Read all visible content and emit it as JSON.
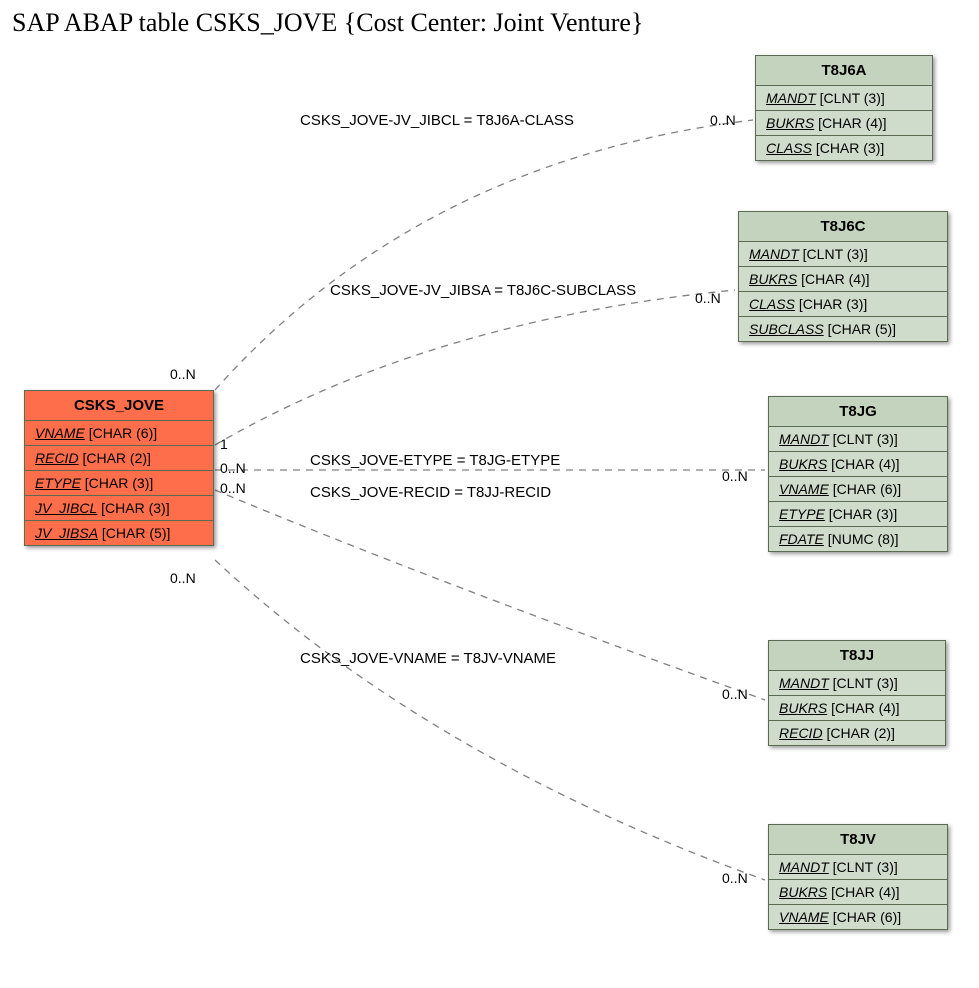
{
  "title": "SAP ABAP table CSKS_JOVE {Cost Center: Joint Venture}",
  "primary": {
    "name": "CSKS_JOVE",
    "fields": [
      {
        "name": "VNAME",
        "type": "[CHAR (6)]"
      },
      {
        "name": "RECID",
        "type": "[CHAR (2)]"
      },
      {
        "name": "ETYPE",
        "type": "[CHAR (3)]"
      },
      {
        "name": "JV_JIBCL",
        "type": "[CHAR (3)]"
      },
      {
        "name": "JV_JIBSA",
        "type": "[CHAR (5)]"
      }
    ]
  },
  "secondaries": [
    {
      "name": "T8J6A",
      "fields": [
        {
          "name": "MANDT",
          "type": "[CLNT (3)]"
        },
        {
          "name": "BUKRS",
          "type": "[CHAR (4)]"
        },
        {
          "name": "CLASS",
          "type": "[CHAR (3)]"
        }
      ]
    },
    {
      "name": "T8J6C",
      "fields": [
        {
          "name": "MANDT",
          "type": "[CLNT (3)]"
        },
        {
          "name": "BUKRS",
          "type": "[CHAR (4)]"
        },
        {
          "name": "CLASS",
          "type": "[CHAR (3)]"
        },
        {
          "name": "SUBCLASS",
          "type": "[CHAR (5)]"
        }
      ]
    },
    {
      "name": "T8JG",
      "fields": [
        {
          "name": "MANDT",
          "type": "[CLNT (3)]"
        },
        {
          "name": "BUKRS",
          "type": "[CHAR (4)]"
        },
        {
          "name": "VNAME",
          "type": "[CHAR (6)]"
        },
        {
          "name": "ETYPE",
          "type": "[CHAR (3)]"
        },
        {
          "name": "FDATE",
          "type": "[NUMC (8)]"
        }
      ]
    },
    {
      "name": "T8JJ",
      "fields": [
        {
          "name": "MANDT",
          "type": "[CLNT (3)]"
        },
        {
          "name": "BUKRS",
          "type": "[CHAR (4)]"
        },
        {
          "name": "RECID",
          "type": "[CHAR (2)]"
        }
      ]
    },
    {
      "name": "T8JV",
      "fields": [
        {
          "name": "MANDT",
          "type": "[CLNT (3)]"
        },
        {
          "name": "BUKRS",
          "type": "[CHAR (4)]"
        },
        {
          "name": "VNAME",
          "type": "[CHAR (6)]"
        }
      ]
    }
  ],
  "relations": {
    "r1": "CSKS_JOVE-JV_JIBCL = T8J6A-CLASS",
    "r2": "CSKS_JOVE-JV_JIBSA = T8J6C-SUBCLASS",
    "r3": "CSKS_JOVE-ETYPE = T8JG-ETYPE",
    "r4": "CSKS_JOVE-RECID = T8JJ-RECID",
    "r5": "CSKS_JOVE-VNAME = T8JV-VNAME"
  },
  "cardinalities": {
    "left_top": "0..N",
    "left_r2": "1",
    "left_r3": "0..N",
    "left_r4": "0..N",
    "left_bottom": "0..N",
    "right_r1": "0..N",
    "right_r2": "0..N",
    "right_r3": "0..N",
    "right_r4": "0..N",
    "right_r5": "0..N"
  }
}
